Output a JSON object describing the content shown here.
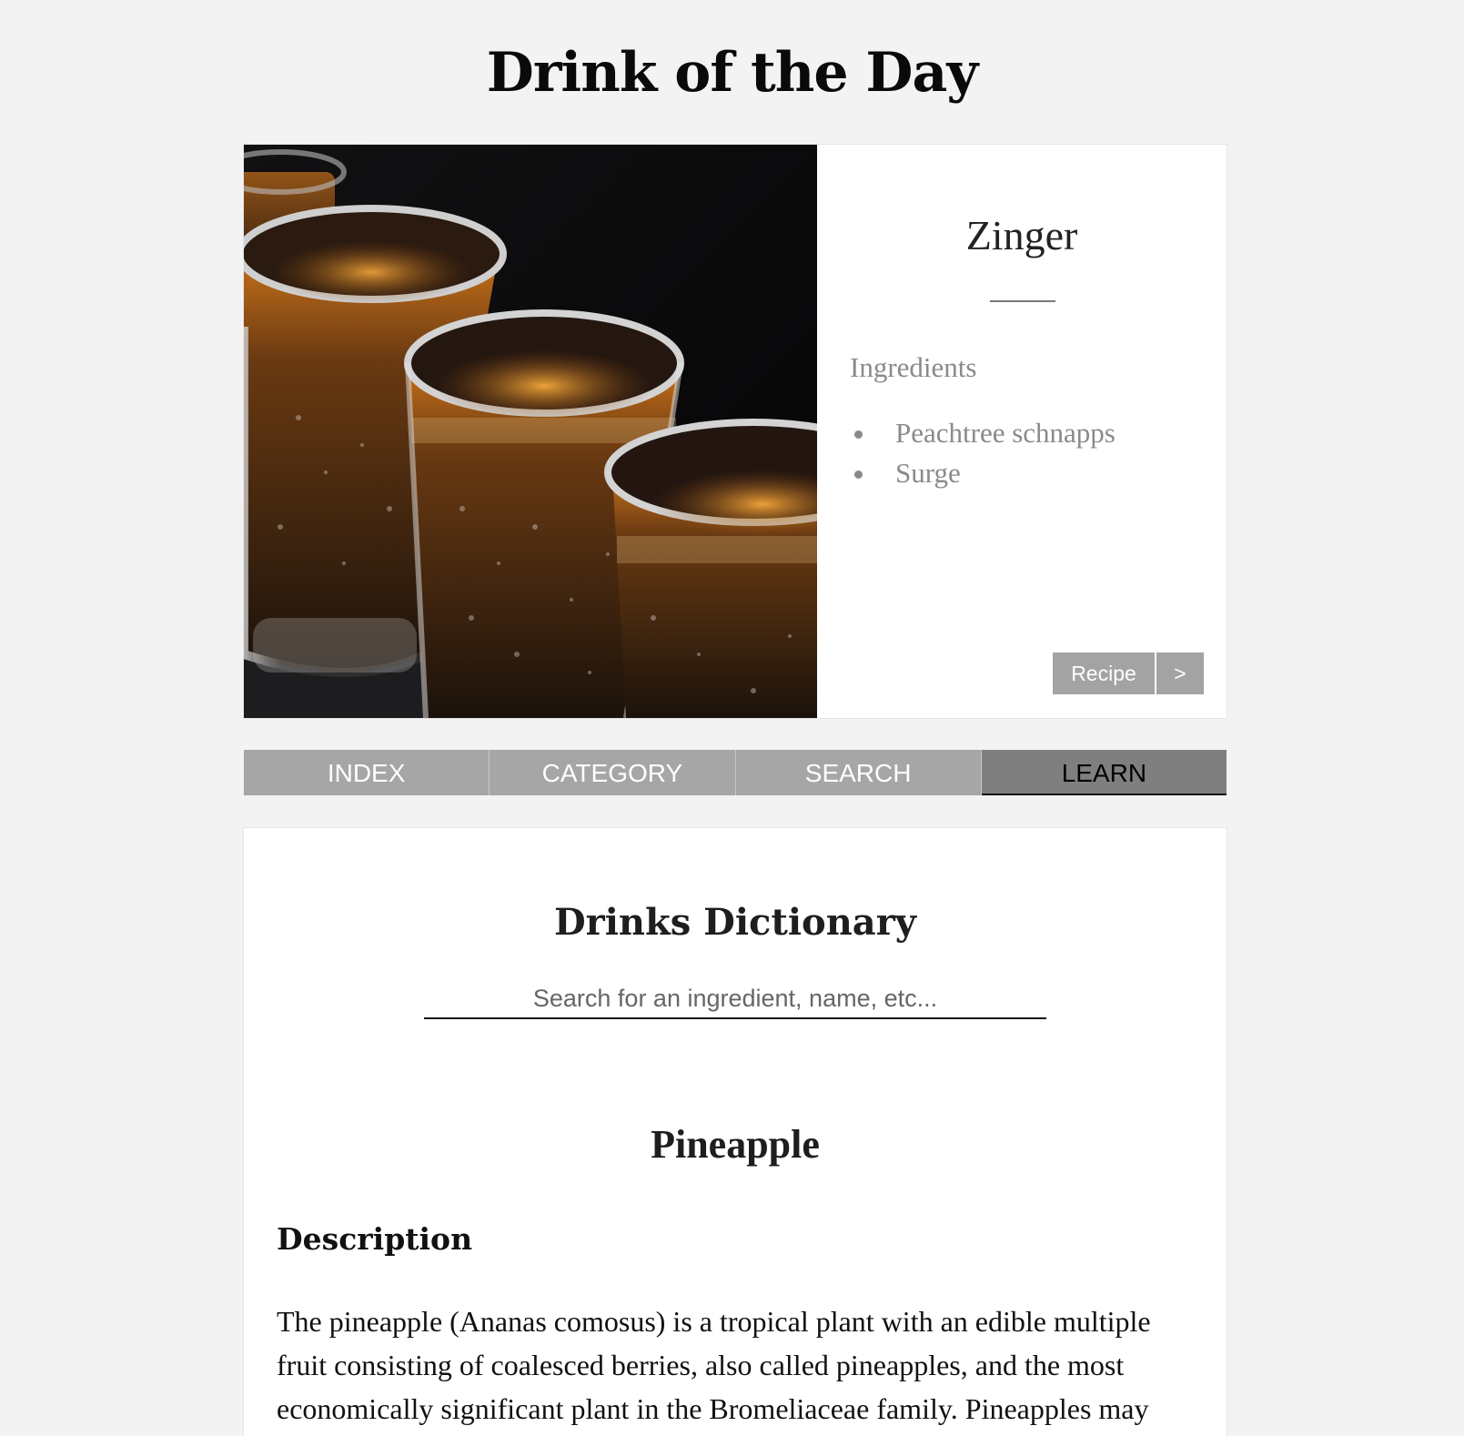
{
  "page": {
    "title": "Drink of the Day"
  },
  "featured_drink": {
    "photo_icon": "shot-glasses-photo",
    "name": "Zinger",
    "ingredients_heading": "Ingredients",
    "ingredients": [
      "Peachtree schnapps",
      "Surge"
    ],
    "recipe_label": "Recipe",
    "next_label": ">"
  },
  "tabs": [
    {
      "label": "INDEX",
      "active": false
    },
    {
      "label": "CATEGORY",
      "active": false
    },
    {
      "label": "SEARCH",
      "active": false
    },
    {
      "label": "LEARN",
      "active": true
    }
  ],
  "dictionary": {
    "title": "Drinks Dictionary",
    "search_placeholder": "Search for an ingredient, name, etc...",
    "search_value": "",
    "term": "Pineapple",
    "section_heading": "Description",
    "description": "The pineapple (Ananas comosus) is a tropical plant with an edible multiple fruit consisting of coalesced berries, also called pineapples, and the most economically significant plant in the Bromeliaceae family. Pineapples may"
  },
  "colors": {
    "background": "#f3f3f3",
    "tab_inactive": "#a6a6a6",
    "tab_active": "#7f7f7f",
    "button": "#a3a3a3",
    "muted_text": "#8a8a8a"
  }
}
